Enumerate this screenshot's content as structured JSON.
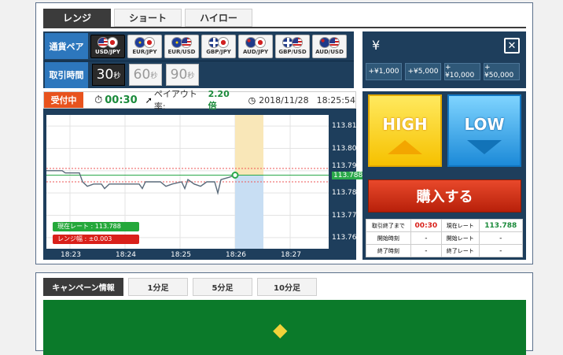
{
  "main_tabs": [
    "レンジ",
    "ショート",
    "ハイロー"
  ],
  "pair_label": "通貨ペア",
  "pairs": [
    {
      "name": "USD/JPY",
      "flags": [
        "us",
        "jp"
      ]
    },
    {
      "name": "EUR/JPY",
      "flags": [
        "eu",
        "jp"
      ]
    },
    {
      "name": "EUR/USD",
      "flags": [
        "eu",
        "us"
      ]
    },
    {
      "name": "GBP/JPY",
      "flags": [
        "gb",
        "jp"
      ]
    },
    {
      "name": "AUD/JPY",
      "flags": [
        "au",
        "jp"
      ]
    },
    {
      "name": "GBP/USD",
      "flags": [
        "gb",
        "us"
      ]
    },
    {
      "name": "AUD/USD",
      "flags": [
        "au",
        "us"
      ]
    }
  ],
  "time_label": "取引時間",
  "times": [
    {
      "num": "30",
      "unit": "秒"
    },
    {
      "num": "60",
      "unit": "秒"
    },
    {
      "num": "90",
      "unit": "秒"
    }
  ],
  "currency_symbol": "¥",
  "close_symbol": "✕",
  "amounts": [
    "+¥1,000",
    "+¥5,000",
    "+¥10,000",
    "+¥50,000"
  ],
  "status": {
    "badge": "受付中",
    "timer": "00:30",
    "payout_label": "ペイアウト率:",
    "payout_value": "2.20 倍",
    "date": "2018/11/28",
    "time": "18:25:54"
  },
  "chart_data": {
    "type": "line",
    "x": [
      "18:23",
      "18:24",
      "18:25",
      "18:26",
      "18:27"
    ],
    "yticks": [
      "113.810",
      "113.800",
      "113.790",
      "113.788",
      "113.780",
      "113.770",
      "113.760"
    ],
    "ylim": [
      113.755,
      113.815
    ],
    "series": [
      {
        "values": [
          113.79,
          113.79,
          113.789,
          113.785,
          113.784,
          113.784,
          113.786,
          113.788
        ]
      }
    ],
    "current_rate": 113.788
  },
  "legend": {
    "current_label": "現在レート",
    "current_value": "113.788",
    "range_label": "レンジ幅",
    "range_value": "±0.003"
  },
  "buttons": {
    "high": "HIGH",
    "low": "LOW",
    "buy": "購入する"
  },
  "info": {
    "r1": [
      "取引終了まで",
      "00:30",
      "現在レート",
      "113.788"
    ],
    "r2": [
      "開始時刻",
      "-",
      "開始レート",
      "-"
    ],
    "r3": [
      "終了時刻",
      "-",
      "終了レート",
      "-"
    ]
  },
  "campaign_tabs": [
    "キャンペーン情報",
    "1分足",
    "5分足",
    "10分足"
  ],
  "colors": {
    "navy": "#1e3e5c",
    "high": "#f6c100",
    "low": "#1c8ad8",
    "buy": "#c83015"
  }
}
